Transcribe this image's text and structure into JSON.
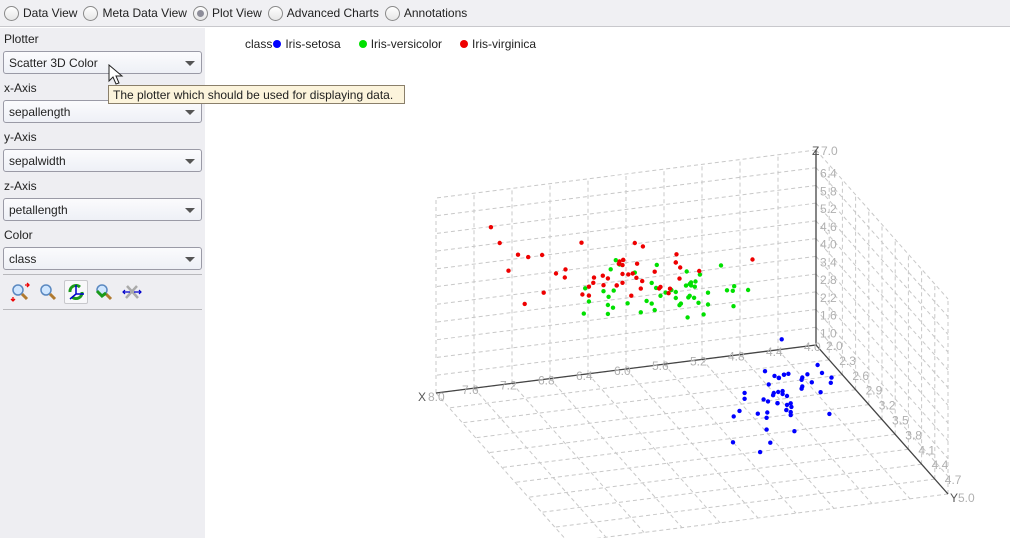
{
  "tabs": [
    {
      "label": "Data View",
      "selected": false
    },
    {
      "label": "Meta Data View",
      "selected": false
    },
    {
      "label": "Plot View",
      "selected": true
    },
    {
      "label": "Advanced Charts",
      "selected": false
    },
    {
      "label": "Annotations",
      "selected": false
    }
  ],
  "sidebar": {
    "plotter": {
      "label": "Plotter",
      "value": "Scatter 3D Color"
    },
    "x_axis": {
      "label": "x-Axis",
      "value": "sepallength"
    },
    "y_axis": {
      "label": "y-Axis",
      "value": "sepalwidth"
    },
    "z_axis": {
      "label": "z-Axis",
      "value": "petallength"
    },
    "color": {
      "label": "Color",
      "value": "class"
    },
    "tools": [
      "zoom-in-icon",
      "zoom-icon",
      "rotate-icon",
      "zoom-back-icon",
      "scale-icon"
    ],
    "active_tool": 2
  },
  "tooltip": "The plotter which should be used for displaying data.",
  "chart_data": {
    "type": "scatter",
    "legend_title": "class",
    "legend_placement": "top-left",
    "series": [
      {
        "name": "Iris-setosa",
        "color": "#0000ff",
        "points": [
          [
            5.1,
            3.5,
            1.4
          ],
          [
            4.9,
            3.0,
            1.4
          ],
          [
            4.7,
            3.2,
            1.3
          ],
          [
            4.6,
            3.1,
            1.5
          ],
          [
            5.0,
            3.6,
            1.4
          ],
          [
            5.4,
            3.9,
            1.7
          ],
          [
            4.6,
            3.4,
            1.4
          ],
          [
            5.0,
            3.4,
            1.5
          ],
          [
            4.4,
            2.9,
            1.4
          ],
          [
            4.9,
            3.1,
            1.5
          ],
          [
            5.4,
            3.7,
            1.5
          ],
          [
            4.8,
            3.4,
            1.6
          ],
          [
            4.8,
            3.0,
            1.4
          ],
          [
            4.3,
            3.0,
            1.1
          ],
          [
            5.8,
            4.0,
            1.2
          ],
          [
            5.7,
            4.4,
            1.5
          ],
          [
            5.4,
            3.9,
            1.3
          ],
          [
            5.1,
            3.5,
            1.4
          ],
          [
            5.7,
            3.8,
            1.7
          ],
          [
            5.1,
            3.8,
            1.5
          ],
          [
            5.4,
            3.4,
            1.7
          ],
          [
            5.1,
            3.7,
            1.5
          ],
          [
            4.6,
            3.6,
            1.0
          ],
          [
            5.1,
            3.3,
            1.7
          ],
          [
            4.8,
            3.4,
            1.9
          ],
          [
            5.0,
            3.0,
            1.6
          ],
          [
            5.0,
            3.4,
            1.6
          ],
          [
            5.2,
            3.5,
            1.5
          ],
          [
            5.2,
            3.4,
            1.4
          ],
          [
            4.7,
            3.2,
            1.6
          ],
          [
            4.8,
            3.1,
            1.6
          ],
          [
            5.4,
            3.4,
            1.5
          ],
          [
            5.2,
            4.1,
            1.5
          ],
          [
            5.5,
            4.2,
            1.4
          ],
          [
            4.9,
            3.1,
            1.5
          ],
          [
            5.0,
            3.2,
            1.2
          ],
          [
            5.5,
            3.5,
            1.3
          ],
          [
            4.9,
            3.1,
            1.5
          ],
          [
            4.4,
            3.0,
            1.3
          ],
          [
            5.1,
            3.4,
            1.5
          ],
          [
            5.0,
            3.5,
            1.3
          ],
          [
            4.5,
            2.3,
            1.3
          ],
          [
            4.4,
            3.2,
            1.3
          ],
          [
            5.0,
            3.5,
            1.6
          ],
          [
            5.1,
            3.8,
            1.9
          ],
          [
            4.8,
            3.0,
            1.4
          ],
          [
            5.1,
            3.8,
            1.6
          ],
          [
            4.6,
            3.2,
            1.4
          ],
          [
            5.3,
            3.7,
            1.5
          ],
          [
            5.0,
            3.3,
            1.4
          ]
        ]
      },
      {
        "name": "Iris-versicolor",
        "color": "#00e000",
        "points": [
          [
            7.0,
            3.2,
            4.7
          ],
          [
            6.4,
            3.2,
            4.5
          ],
          [
            6.9,
            3.1,
            4.9
          ],
          [
            5.5,
            2.3,
            4.0
          ],
          [
            6.5,
            2.8,
            4.6
          ],
          [
            5.7,
            2.8,
            4.5
          ],
          [
            6.3,
            3.3,
            4.7
          ],
          [
            4.9,
            2.4,
            3.3
          ],
          [
            6.6,
            2.9,
            4.6
          ],
          [
            5.2,
            2.7,
            3.9
          ],
          [
            5.0,
            2.0,
            3.5
          ],
          [
            5.9,
            3.0,
            4.2
          ],
          [
            6.0,
            2.2,
            4.0
          ],
          [
            6.1,
            2.9,
            4.7
          ],
          [
            5.6,
            2.9,
            3.6
          ],
          [
            6.7,
            3.1,
            4.4
          ],
          [
            5.6,
            3.0,
            4.5
          ],
          [
            5.8,
            2.7,
            4.1
          ],
          [
            6.2,
            2.2,
            4.5
          ],
          [
            5.6,
            2.5,
            3.9
          ],
          [
            5.9,
            3.2,
            4.8
          ],
          [
            6.1,
            2.8,
            4.0
          ],
          [
            6.3,
            2.5,
            4.9
          ],
          [
            6.1,
            2.8,
            4.7
          ],
          [
            6.4,
            2.9,
            4.3
          ],
          [
            6.6,
            3.0,
            4.4
          ],
          [
            6.8,
            2.8,
            4.8
          ],
          [
            6.7,
            3.0,
            5.0
          ],
          [
            6.0,
            2.9,
            4.5
          ],
          [
            5.7,
            2.6,
            3.5
          ],
          [
            5.5,
            2.4,
            3.8
          ],
          [
            5.5,
            2.4,
            3.7
          ],
          [
            5.8,
            2.7,
            3.9
          ],
          [
            6.0,
            2.7,
            5.1
          ],
          [
            5.4,
            3.0,
            4.5
          ],
          [
            6.0,
            3.4,
            4.5
          ],
          [
            6.7,
            3.1,
            4.7
          ],
          [
            6.3,
            2.3,
            4.4
          ],
          [
            5.6,
            3.0,
            4.1
          ],
          [
            5.5,
            2.5,
            4.0
          ],
          [
            5.5,
            2.6,
            4.4
          ],
          [
            6.1,
            3.0,
            4.6
          ],
          [
            5.8,
            2.6,
            4.0
          ],
          [
            5.0,
            2.3,
            3.3
          ],
          [
            5.6,
            2.7,
            4.2
          ],
          [
            5.7,
            3.0,
            4.2
          ],
          [
            5.7,
            2.9,
            4.2
          ],
          [
            6.2,
            2.9,
            4.3
          ],
          [
            5.1,
            2.5,
            3.0
          ],
          [
            5.7,
            2.8,
            4.1
          ]
        ]
      },
      {
        "name": "Iris-virginica",
        "color": "#ee0000",
        "points": [
          [
            6.3,
            3.3,
            6.0
          ],
          [
            5.8,
            2.7,
            5.1
          ],
          [
            7.1,
            3.0,
            5.9
          ],
          [
            6.3,
            2.9,
            5.6
          ],
          [
            6.5,
            3.0,
            5.8
          ],
          [
            7.6,
            3.0,
            6.6
          ],
          [
            4.9,
            2.5,
            4.5
          ],
          [
            7.3,
            2.9,
            6.3
          ],
          [
            6.7,
            2.5,
            5.8
          ],
          [
            7.2,
            3.6,
            6.1
          ],
          [
            6.5,
            3.2,
            5.1
          ],
          [
            6.4,
            2.7,
            5.3
          ],
          [
            6.8,
            3.0,
            5.5
          ],
          [
            5.7,
            2.5,
            5.0
          ],
          [
            5.8,
            2.8,
            5.1
          ],
          [
            6.4,
            3.2,
            5.3
          ],
          [
            6.5,
            3.0,
            5.5
          ],
          [
            7.7,
            3.8,
            6.7
          ],
          [
            7.7,
            2.6,
            6.9
          ],
          [
            6.0,
            2.2,
            5.0
          ],
          [
            6.9,
            3.2,
            5.7
          ],
          [
            5.6,
            2.8,
            4.9
          ],
          [
            7.7,
            2.8,
            6.7
          ],
          [
            6.3,
            2.7,
            4.9
          ],
          [
            6.7,
            3.3,
            5.7
          ],
          [
            7.2,
            3.2,
            6.0
          ],
          [
            6.2,
            2.8,
            4.8
          ],
          [
            6.1,
            3.0,
            4.9
          ],
          [
            6.4,
            2.8,
            5.6
          ],
          [
            7.2,
            3.0,
            5.8
          ],
          [
            7.4,
            2.8,
            6.1
          ],
          [
            7.9,
            3.8,
            6.4
          ],
          [
            6.4,
            2.8,
            5.6
          ],
          [
            6.3,
            2.8,
            5.1
          ],
          [
            6.1,
            2.6,
            5.6
          ],
          [
            7.7,
            3.0,
            6.1
          ],
          [
            6.3,
            3.4,
            5.6
          ],
          [
            6.4,
            3.1,
            5.5
          ],
          [
            6.0,
            3.0,
            4.8
          ],
          [
            6.9,
            3.1,
            5.4
          ],
          [
            6.7,
            3.1,
            5.6
          ],
          [
            6.9,
            3.1,
            5.1
          ],
          [
            5.8,
            2.7,
            5.1
          ],
          [
            6.8,
            3.2,
            5.9
          ],
          [
            6.7,
            3.3,
            5.7
          ],
          [
            6.7,
            3.0,
            5.2
          ],
          [
            6.3,
            2.5,
            5.0
          ],
          [
            6.5,
            3.0,
            5.2
          ],
          [
            6.2,
            3.4,
            5.4
          ],
          [
            5.9,
            3.0,
            5.1
          ]
        ]
      }
    ],
    "x_axis": {
      "label": "X",
      "range": [
        4.0,
        8.0
      ],
      "ticks": [
        "4.0",
        "4.4",
        "4.8",
        "5.2",
        "5.6",
        "6.0",
        "6.4",
        "6.8",
        "7.2",
        "7.6",
        "8.0"
      ]
    },
    "y_axis": {
      "label": "Y",
      "range": [
        2.0,
        5.0
      ],
      "ticks": [
        "2.0",
        "2.3",
        "2.6",
        "2.9",
        "3.2",
        "3.5",
        "3.8",
        "4.1",
        "4.4",
        "4.7",
        "5.0"
      ]
    },
    "z_axis": {
      "label": "Z",
      "range": [
        0.4,
        7.0
      ],
      "ticks": [
        "1.0",
        "1.6",
        "2.2",
        "2.8",
        "3.4",
        "4.0",
        "4.6",
        "5.2",
        "5.8",
        "6.4",
        "7.0"
      ]
    },
    "grid": true
  }
}
